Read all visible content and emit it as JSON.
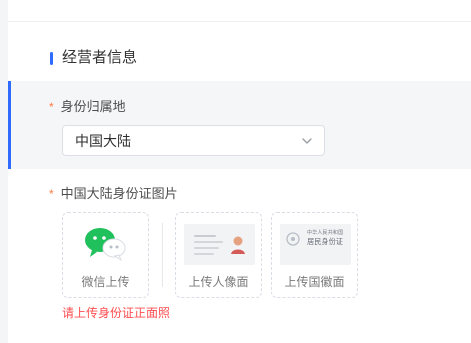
{
  "section": {
    "title": "经营者信息"
  },
  "fields": {
    "region": {
      "required_mark": "*",
      "label": "身份归属地",
      "value": "中国大陆"
    },
    "id_images": {
      "required_mark": "*",
      "label": "中国大陆身份证图片",
      "options": [
        {
          "label": "微信上传",
          "icon": "wechat-icon"
        },
        {
          "label": "上传人像面",
          "icon": "id-portrait-icon"
        },
        {
          "label": "上传国徽面",
          "icon": "id-emblem-icon"
        }
      ],
      "error": "请上传身份证正面照",
      "id_card_text": {
        "line1": "中华人民共和国",
        "line2": "居民身份证"
      }
    }
  },
  "colors": {
    "accent": "#2f6bff",
    "required": "#ff7a45",
    "error": "#ff4d4f",
    "wechat_green": "#20c05c"
  }
}
